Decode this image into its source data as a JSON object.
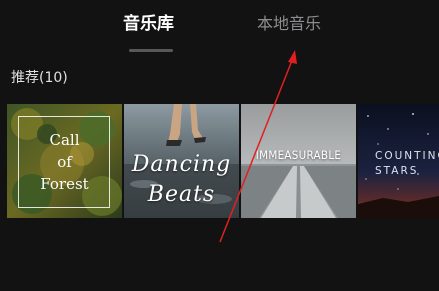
{
  "tabs": [
    {
      "label": "音乐库",
      "active": true
    },
    {
      "label": "本地音乐",
      "active": false
    }
  ],
  "section": {
    "title": "推荐(10)"
  },
  "albums": [
    {
      "title": "Call\nof\nForest"
    },
    {
      "title": "Dancing\nBeats"
    },
    {
      "title": "IMMEASURABLE"
    },
    {
      "title": "COUNTING\nSTARS"
    }
  ],
  "colors": {
    "background": "#121213",
    "active_tab": "#ffffff",
    "inactive_tab": "#8d8d8f",
    "indicator": "#58585a",
    "annotation_arrow": "#e02020"
  }
}
